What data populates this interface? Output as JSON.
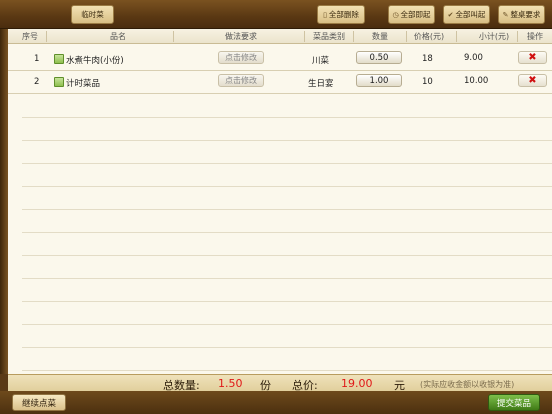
{
  "toolbar": {
    "temp_dish": "临时菜",
    "delete_all": "全部删除",
    "start_all": "全部即起",
    "call_all": "全部叫起",
    "table_request": "整桌要求"
  },
  "table": {
    "headers": [
      "序号",
      "品名",
      "做法要求",
      "菜品类别",
      "数量",
      "价格(元)",
      "小计(元)",
      "操作"
    ],
    "rows": [
      {
        "no": "1",
        "name": "水煮牛肉(小份)",
        "modify": "点击修改",
        "category": "川菜",
        "qty": "0.50",
        "price": "18",
        "subtotal": "9.00"
      },
      {
        "no": "2",
        "name": "计时菜品",
        "modify": "点击修改",
        "category": "生日宴",
        "qty": "1.00",
        "price": "10",
        "subtotal": "10.00"
      }
    ]
  },
  "totals": {
    "qty_label": "总数量:",
    "qty_value": "1.50",
    "qty_unit": "份",
    "price_label": "总价:",
    "price_value": "19.00",
    "price_unit": "元",
    "note": "(实际应收金额以收银为准)"
  },
  "footer": {
    "continue": "继续点菜",
    "submit": "提交菜品"
  },
  "icons": {
    "delete_row": "close-icon",
    "dish": "dish-icon"
  },
  "colors": {
    "accent_red": "#e01818",
    "submit_green": "#4f8a1e"
  }
}
